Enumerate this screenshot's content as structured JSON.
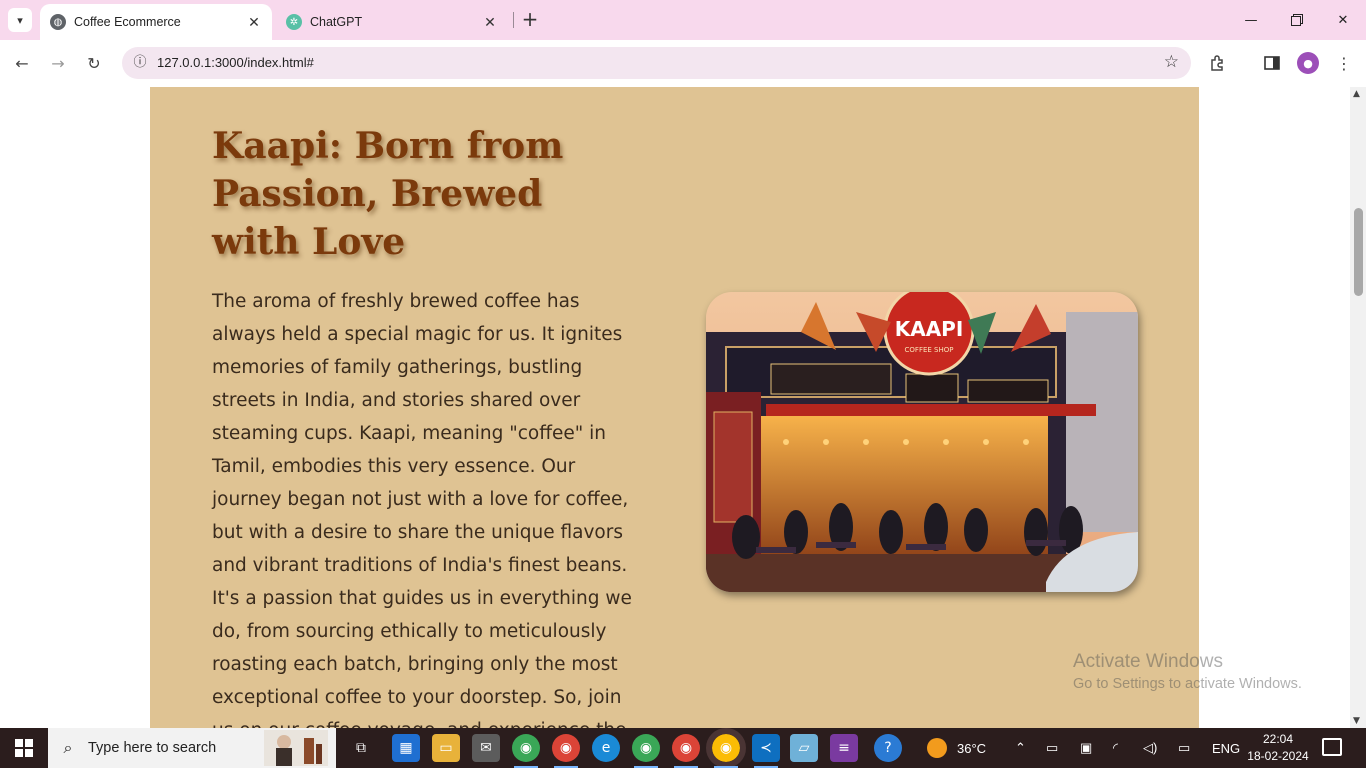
{
  "browser": {
    "tabs": [
      {
        "title": "Coffee Ecommerce",
        "icon": "globe-icon",
        "active": true
      },
      {
        "title": "ChatGPT",
        "icon": "chatgpt-icon",
        "active": false
      }
    ],
    "address": "127.0.0.1:3000/index.html#"
  },
  "page": {
    "heading": "Kaapi: Born from Passion, Brewed with Love",
    "paragraph": "The aroma of freshly brewed coffee has always held a special magic for us. It ignites memories of family gatherings, bustling streets in India, and stories shared over steaming cups. Kaapi, meaning \"coffee\" in Tamil, embodies this very essence. Our journey began not just with a love for coffee, but with a desire to share the unique flavors and vibrant traditions of India's finest beans. It's a passion that guides us in everything we do, from sourcing ethically to meticulously roasting each batch, bringing only the most exceptional coffee to your doorstep. So, join us on our coffee voyage, and experience the taste of authentic",
    "image": {
      "sign": "KAAPI",
      "sign_sub": "COFFEE SHOP"
    }
  },
  "watermark": {
    "line1": "Activate Windows",
    "line2": "Go to Settings to activate Windows."
  },
  "taskbar": {
    "search_placeholder": "Type here to search",
    "temperature": "36°C",
    "language": "ENG",
    "time": "22:04",
    "date": "18-02-2024"
  },
  "colors": {
    "chrome_bg": "#f8d9ed",
    "panel_bg": "#dfc393",
    "heading": "#7b3a0c",
    "text": "#3a2b1d",
    "taskbar": "#2b1d1d"
  }
}
